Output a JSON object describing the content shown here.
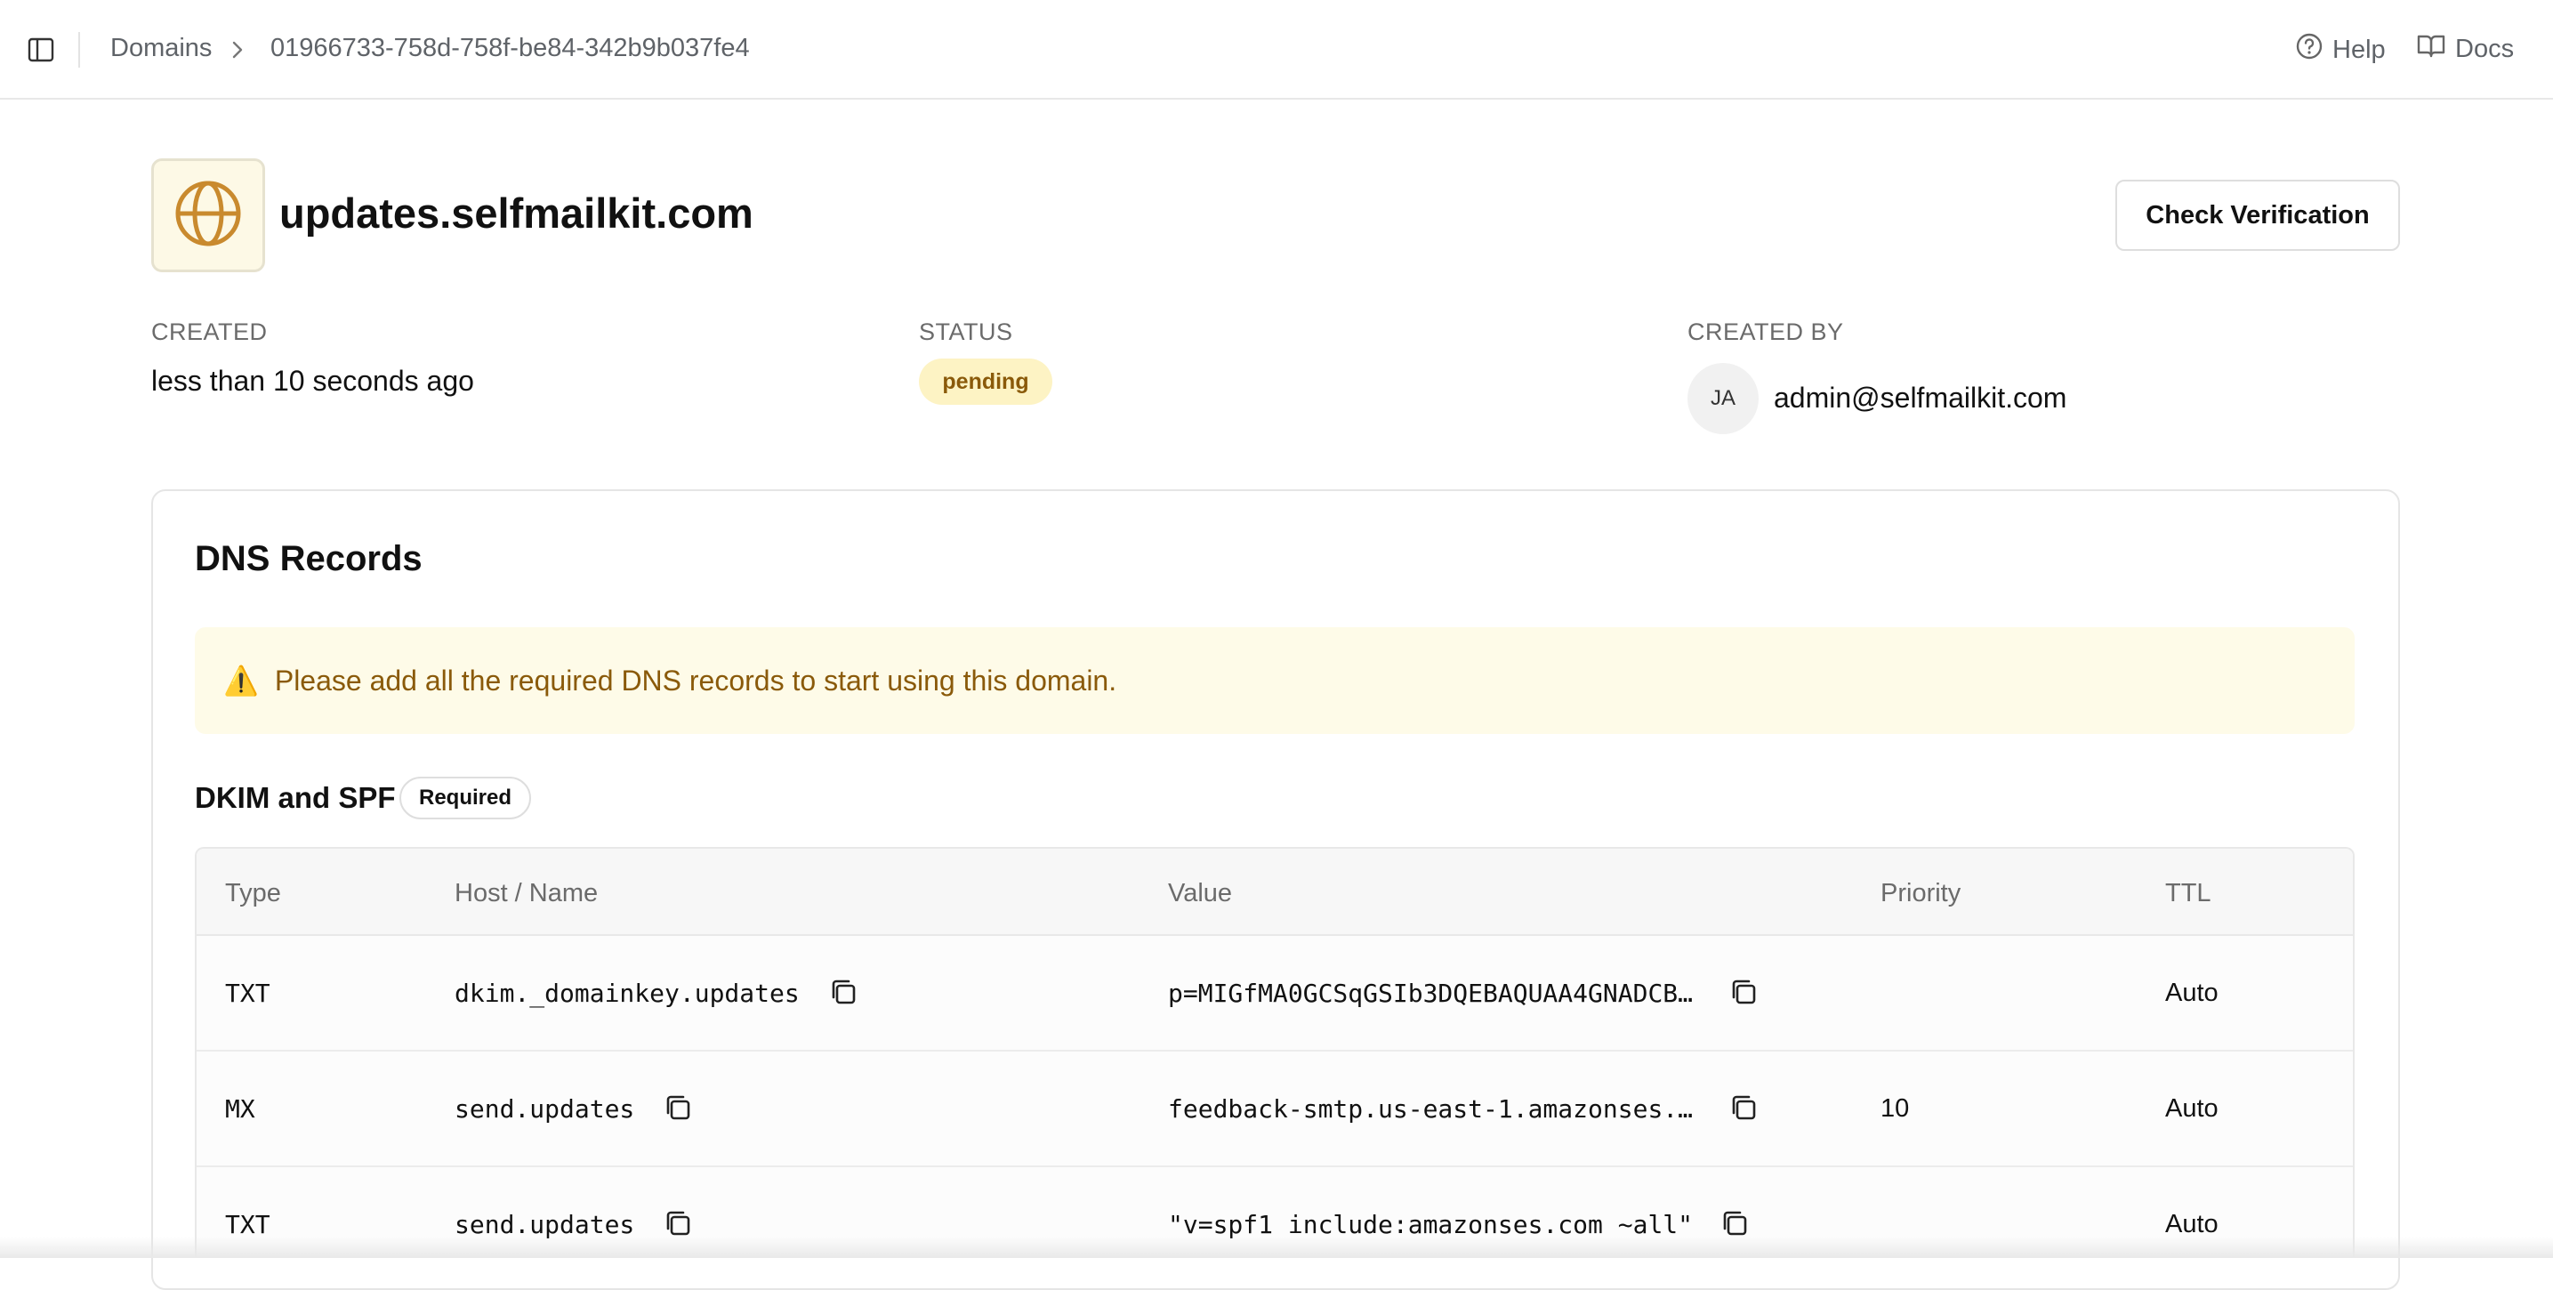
{
  "header": {
    "breadcrumb": [
      "Domains",
      "01966733-758d-758f-be84-342b9b037fe4"
    ],
    "help_label": "Help",
    "docs_label": "Docs"
  },
  "domain": {
    "name": "updates.selfmailkit.com",
    "check_button_label": "Check Verification",
    "created_label": "CREATED",
    "created_value": "less than 10 seconds ago",
    "status_label": "STATUS",
    "status_value": "pending",
    "created_by_label": "CREATED BY",
    "avatar_initials": "JA",
    "created_by_value": "admin@selfmailkit.com"
  },
  "dns": {
    "title": "DNS Records",
    "alert_icon": "⚠️",
    "alert_text": "Please add all the required DNS records to start using this domain.",
    "section_title": "DKIM and SPF",
    "section_badge": "Required",
    "columns": [
      "Type",
      "Host / Name",
      "Value",
      "Priority",
      "TTL"
    ],
    "rows": [
      {
        "type": "TXT",
        "host": "dkim._domainkey.updates",
        "value": "p=MIGfMA0GCSqGSIb3DQEBAQUAA4GNADCB…",
        "priority": "",
        "ttl": "Auto"
      },
      {
        "type": "MX",
        "host": "send.updates",
        "value": "feedback-smtp.us-east-1.amazonses.…",
        "priority": "10",
        "ttl": "Auto"
      },
      {
        "type": "TXT",
        "host": "send.updates",
        "value": "\"v=spf1 include:amazonses.com ~all\"",
        "priority": "",
        "ttl": "Auto"
      }
    ]
  },
  "colors": {
    "accent_icon": "#c98a2e",
    "status_bg": "#fdf3c4",
    "status_text": "#8a5a0a",
    "alert_bg": "#fefbe8"
  }
}
